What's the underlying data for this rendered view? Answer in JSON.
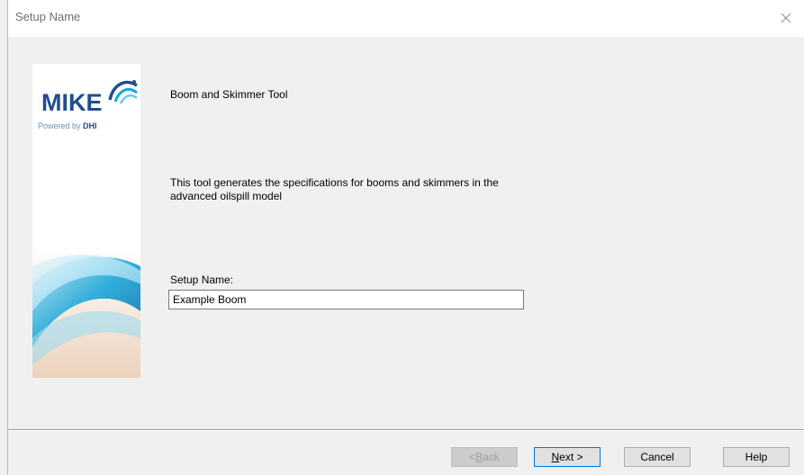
{
  "window": {
    "title": "Setup Name",
    "close_icon": "close-icon"
  },
  "logo": {
    "brand": "MIKE",
    "tagline_prefix": "Powered by ",
    "tagline_brand": "DHI",
    "colors": {
      "brand": "#1f4f8b",
      "accent": "#19a8d6"
    }
  },
  "content": {
    "product_title": "Boom and Skimmer Tool",
    "description": "This tool generates the specifications for booms and skimmers in the advanced oilspill model",
    "setup_label": "Setup Name:",
    "setup_value": "Example Boom"
  },
  "buttons": {
    "back": {
      "prefix": "< ",
      "mnemonic": "B",
      "rest": "ack",
      "enabled": false
    },
    "next": {
      "mnemonic": "N",
      "rest": "ext >",
      "enabled": true
    },
    "cancel": {
      "label": "Cancel"
    },
    "help": {
      "label": "Help"
    }
  }
}
